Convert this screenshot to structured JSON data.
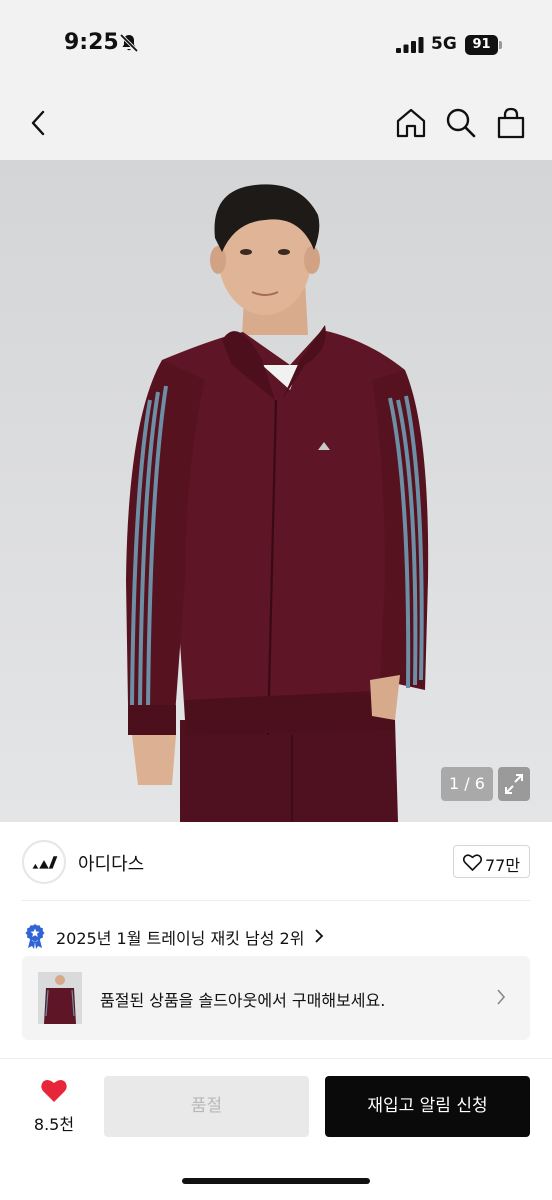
{
  "status_bar": {
    "time": "9:25",
    "network": "5G",
    "battery": "91"
  },
  "nav": {
    "back_icon": "chevron-left-icon",
    "home_icon": "home-icon",
    "search_icon": "search-icon",
    "cart_icon": "shopping-bag-icon"
  },
  "gallery": {
    "pager": "1 / 6",
    "expand_icon": "expand-icon"
  },
  "brand": {
    "name": "아디다스",
    "likes": "77만"
  },
  "ranking": {
    "text": "2025년 1월 트레이닝 재킷 남성 2위"
  },
  "soldout_banner": {
    "text": "품절된 상품을 솔드아웃에서 구매해보세요."
  },
  "bottom_bar": {
    "wish_count": "8.5천",
    "soldout_label": "품절",
    "restock_label": "재입고 알림 신청"
  },
  "colors": {
    "accent_black": "#0a0a0a",
    "heart_red": "#e8263a",
    "jacket_maroon": "#5e1525",
    "stripe_blue": "#6d8fa6"
  }
}
